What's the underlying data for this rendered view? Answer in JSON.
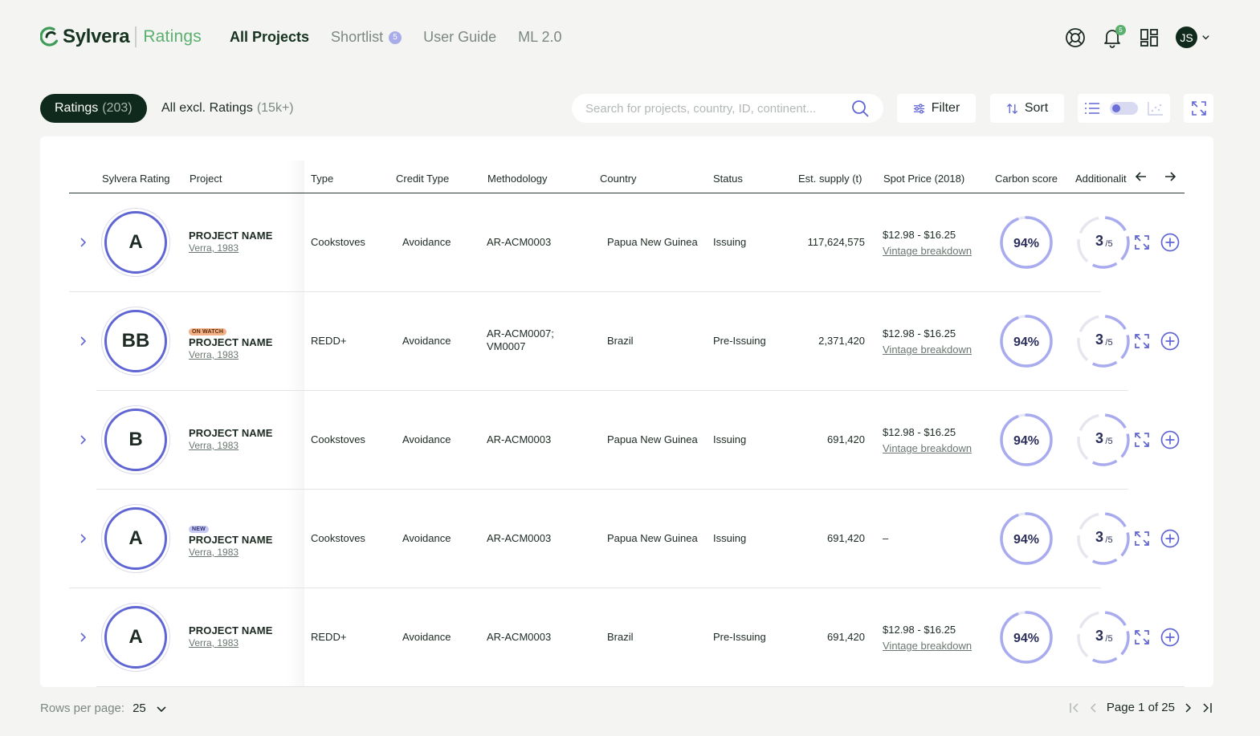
{
  "brand": {
    "name": "Sylvera",
    "product": "Ratings",
    "mark_color": "#3f9b57"
  },
  "nav": [
    {
      "label": "All Projects",
      "active": true
    },
    {
      "label": "Shortlist",
      "badge": "5"
    },
    {
      "label": "User Guide"
    },
    {
      "label": "ML 2.0"
    }
  ],
  "header": {
    "notifications": "5",
    "avatar_initials": "JS",
    "icons": [
      "support-icon",
      "bell-icon",
      "grid-icon",
      "chevron-down-icon"
    ]
  },
  "tabs": [
    {
      "label": "Ratings",
      "count": "(203)",
      "active": true
    },
    {
      "label": "All excl. Ratings",
      "count": "(15k+)"
    }
  ],
  "search": {
    "placeholder": "Search for projects, country, ID, continent..."
  },
  "toolbar": {
    "filter_label": "Filter",
    "sort_label": "Sort"
  },
  "columns": {
    "rating": "Sylvera Rating",
    "project": "Project",
    "type": "Type",
    "credit_type": "Credit Type",
    "methodology": "Methodology",
    "country": "Country",
    "status": "Status",
    "supply": "Est. supply (t)",
    "spot_price": "Spot Price (2018)",
    "carbon": "Carbon score",
    "additionality": "Additionalit"
  },
  "rows": [
    {
      "rating": "A",
      "tag": "",
      "name": "PROJECT NAME",
      "registry": "Verra, 1983",
      "type": "Cookstoves",
      "credit_type": "Avoidance",
      "methodology": "AR-ACM0003",
      "methodology2": "",
      "country": "Papua New Guinea",
      "status": "Issuing",
      "supply": "117,624,575",
      "price": "$12.98 - $16.25",
      "price_link": "Vintage breakdown",
      "carbon": "94%",
      "carbon_value": 94,
      "addl_num": "3",
      "addl_den": "/5",
      "addl_value": 0.6
    },
    {
      "rating": "BB",
      "tag": "ON WATCH",
      "name": "PROJECT NAME",
      "registry": "Verra, 1983",
      "type": "REDD+",
      "credit_type": "Avoidance",
      "methodology": "AR-ACM0007;",
      "methodology2": "VM0007",
      "country": "Brazil",
      "status": "Pre-Issuing",
      "supply": "2,371,420",
      "price": "$12.98 - $16.25",
      "price_link": "Vintage breakdown",
      "carbon": "94%",
      "carbon_value": 94,
      "addl_num": "3",
      "addl_den": "/5",
      "addl_value": 0.6
    },
    {
      "rating": "B",
      "tag": "",
      "name": "PROJECT NAME",
      "registry": "Verra, 1983",
      "type": "Cookstoves",
      "credit_type": "Avoidance",
      "methodology": "AR-ACM0003",
      "methodology2": "",
      "country": "Papua New Guinea",
      "status": "Issuing",
      "supply": "691,420",
      "price": "$12.98 - $16.25",
      "price_link": "Vintage breakdown",
      "carbon": "94%",
      "carbon_value": 94,
      "addl_num": "3",
      "addl_den": "/5",
      "addl_value": 0.6
    },
    {
      "rating": "A",
      "tag": "NEW",
      "name": "PROJECT NAME",
      "registry": "Verra, 1983",
      "type": "Cookstoves",
      "credit_type": "Avoidance",
      "methodology": "AR-ACM0003",
      "methodology2": "",
      "country": "Papua New Guinea",
      "status": "Issuing",
      "supply": "691,420",
      "price": "–",
      "price_link": "",
      "carbon": "94%",
      "carbon_value": 94,
      "addl_num": "3",
      "addl_den": "/5",
      "addl_value": 0.6
    },
    {
      "rating": "A",
      "tag": "",
      "name": "PROJECT NAME",
      "registry": "Verra, 1983",
      "type": "REDD+",
      "credit_type": "Avoidance",
      "methodology": "AR-ACM0003",
      "methodology2": "",
      "country": "Brazil",
      "status": "Pre-Issuing",
      "supply": "691,420",
      "price": "$12.98 - $16.25",
      "price_link": "Vintage breakdown",
      "carbon": "94%",
      "carbon_value": 94,
      "addl_num": "3",
      "addl_den": "/5",
      "addl_value": 0.6
    }
  ],
  "footer": {
    "rows_label": "Rows per page:",
    "rows_value": "25",
    "page_text": "Page 1 of 25"
  },
  "colors": {
    "accent": "#6065d4",
    "ring": "#a9abef",
    "dark": "#0f2a1c",
    "green": "#5bb06f"
  }
}
